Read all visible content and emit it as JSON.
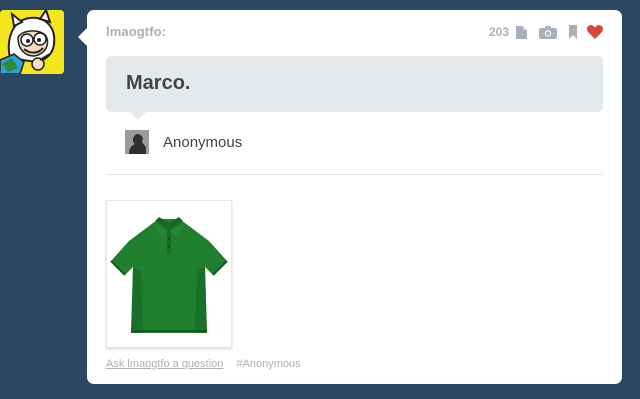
{
  "blog": {
    "username": "lmaogtfo:",
    "avatar_icon": "cartoon-face-avatar"
  },
  "header": {
    "note_count": "203",
    "icons": [
      "text-post-icon",
      "camera-icon",
      "bookmark-icon",
      "heart-icon"
    ],
    "heart_color": "#d95e40"
  },
  "question": {
    "text": "Marco.",
    "asker_name": "Anonymous",
    "asker_avatar_icon": "anonymous-silhouette-icon"
  },
  "photo": {
    "subject": "green-polo-shirt",
    "shirt_color": "#1f7f2f"
  },
  "footer": {
    "ask_link": "Ask lmaogtfo a question",
    "tag": "#Anonymous"
  },
  "colors": {
    "background": "#2c4762",
    "card": "#ffffff",
    "question_bg": "#e6e9ec",
    "muted_text": "#a8b1ba"
  }
}
